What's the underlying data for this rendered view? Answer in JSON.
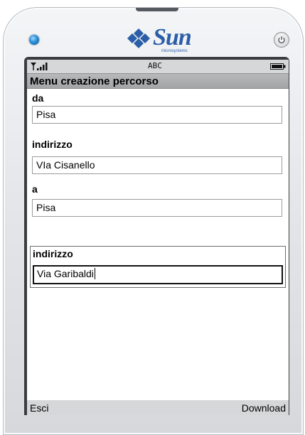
{
  "device": {
    "brand": "Sun",
    "brand_sub": "microsystems"
  },
  "status": {
    "input_mode": "ABC"
  },
  "screen": {
    "title": "Menu creazione percorso"
  },
  "form": {
    "from_label": "da",
    "from_value": "Pisa",
    "from_address_label": "indirizzo",
    "from_address_value": "VIa Cisanello",
    "to_label": "a",
    "to_value": "Pisa",
    "to_address_label": "indirizzo",
    "to_address_value": "Via Garibaldi"
  },
  "softkeys": {
    "left": "Esci",
    "right": "Download"
  },
  "colors": {
    "brand_blue": "#2b5ea8",
    "screen_gray": "#d6d7d9",
    "title_bar": "#a3a4a6"
  },
  "icons": {
    "signal": "signal-strength-icon",
    "battery": "battery-icon",
    "power": "power-icon"
  }
}
